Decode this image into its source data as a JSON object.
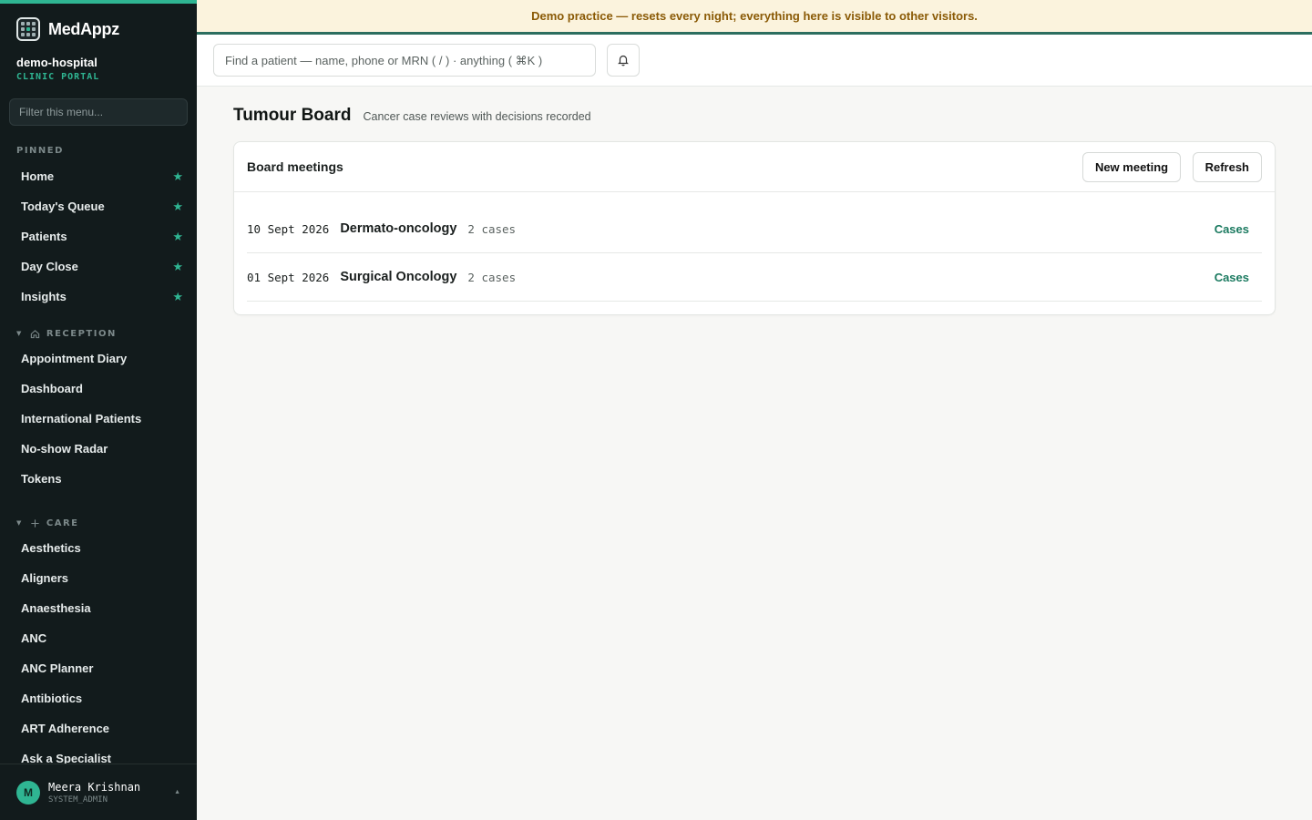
{
  "brand": {
    "name": "MedAppz"
  },
  "org": {
    "name": "demo-hospital",
    "sub": "CLINIC PORTAL"
  },
  "sidebar": {
    "filter_placeholder": "Filter this menu...",
    "pinned_label": "PINNED",
    "pinned": [
      {
        "label": "Home"
      },
      {
        "label": "Today's Queue"
      },
      {
        "label": "Patients"
      },
      {
        "label": "Day Close"
      },
      {
        "label": "Insights"
      }
    ],
    "groups": [
      {
        "label": "RECEPTION",
        "icon": "home-icon",
        "items": [
          {
            "label": "Appointment Diary"
          },
          {
            "label": "Dashboard"
          },
          {
            "label": "International Patients"
          },
          {
            "label": "No-show Radar"
          },
          {
            "label": "Tokens"
          }
        ]
      },
      {
        "label": "CARE",
        "icon": "plus-icon",
        "items": [
          {
            "label": "Aesthetics"
          },
          {
            "label": "Aligners"
          },
          {
            "label": "Anaesthesia"
          },
          {
            "label": "ANC"
          },
          {
            "label": "ANC Planner"
          },
          {
            "label": "Antibiotics"
          },
          {
            "label": "ART Adherence"
          },
          {
            "label": "Ask a Specialist"
          }
        ]
      }
    ]
  },
  "user": {
    "initial": "M",
    "name": "Meera Krishnan",
    "role": "SYSTEM_ADMIN"
  },
  "banner": {
    "text": "Demo practice — resets every night; everything here is visible to other visitors."
  },
  "header": {
    "search_placeholder": "Find a patient — name, phone or MRN ( / ) · anything ( ⌘K )"
  },
  "page": {
    "title": "Tumour Board",
    "subtitle": "Cancer case reviews with decisions recorded"
  },
  "card": {
    "title": "Board meetings",
    "new_label": "New meeting",
    "refresh_label": "Refresh",
    "meetings": [
      {
        "date": "10 Sept 2026",
        "name": "Dermato-oncology",
        "count": "2 cases",
        "link": "Cases"
      },
      {
        "date": "01 Sept 2026",
        "name": "Surgical Oncology",
        "count": "2 cases",
        "link": "Cases"
      }
    ]
  },
  "colors": {
    "accent": "#2fb592",
    "sidebar_bg": "#121b1c",
    "link": "#1b7a60",
    "banner_text": "#8a5a06"
  }
}
